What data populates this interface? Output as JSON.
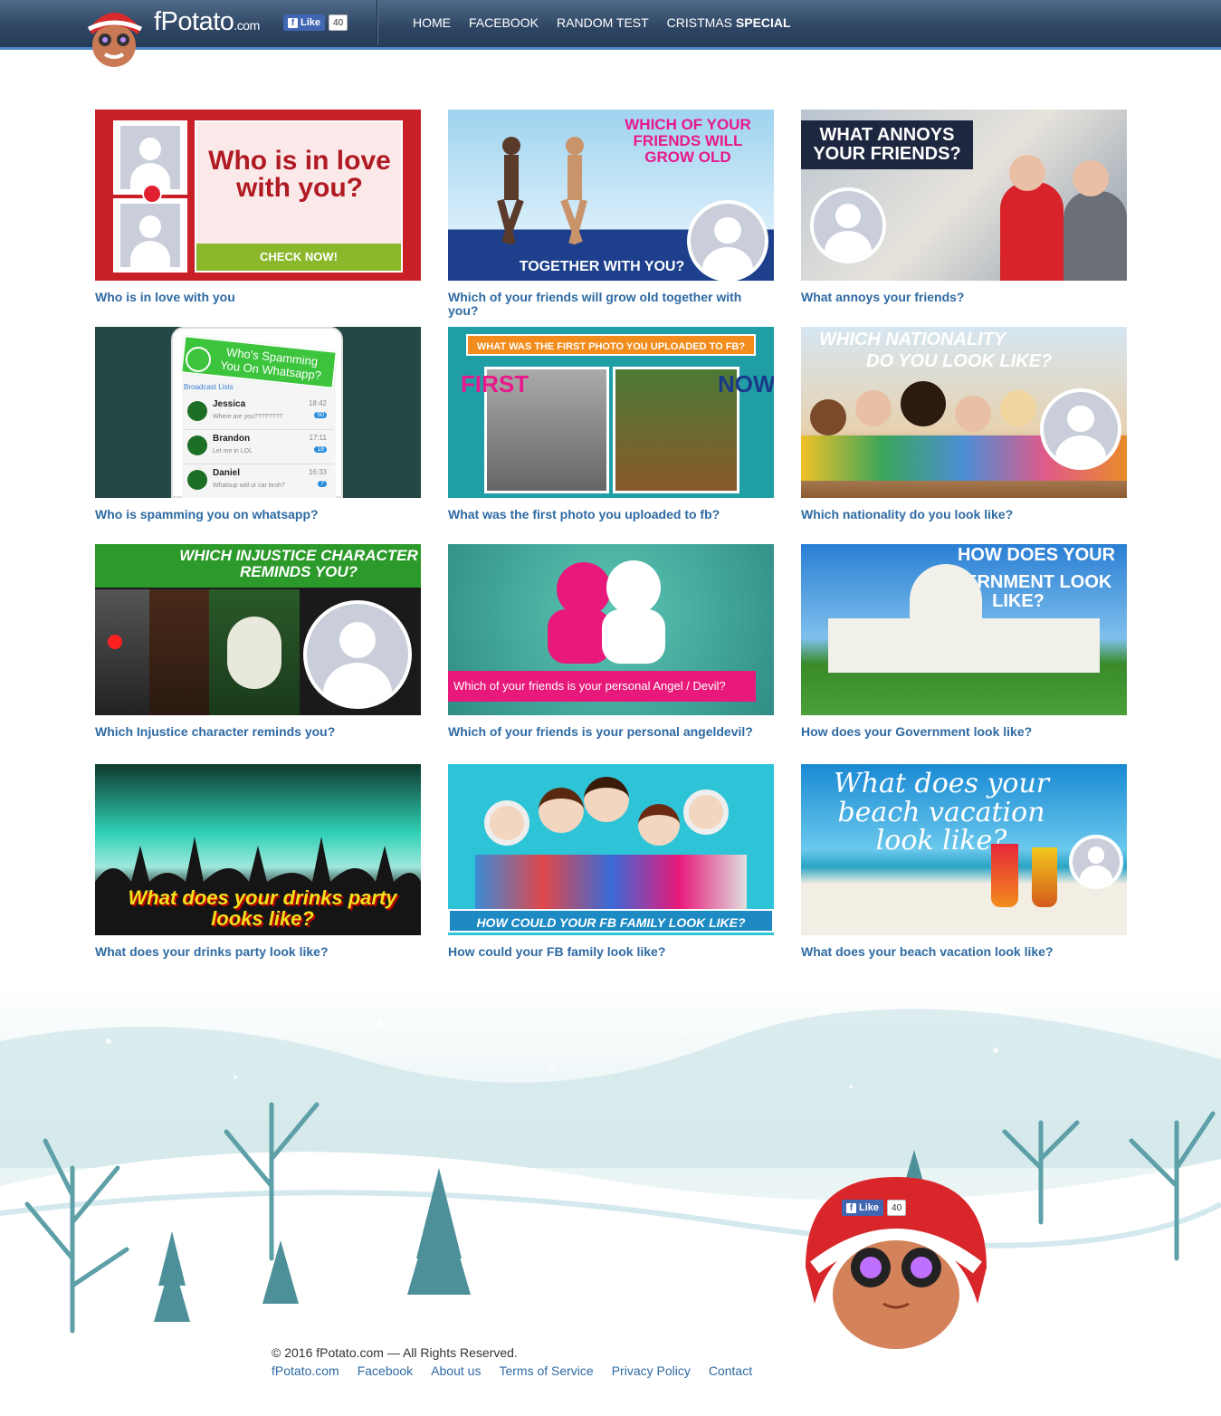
{
  "brand": {
    "name": "fPotato",
    "domain": ".com"
  },
  "fb_like": {
    "label": "Like",
    "count": "40"
  },
  "nav": [
    {
      "label": "HOME"
    },
    {
      "label": "FACEBOOK"
    },
    {
      "label": "RANDOM TEST"
    },
    {
      "label_prefix": "CRISTMAS",
      "label_bold": "SPECIAL"
    }
  ],
  "tests": [
    {
      "caption": "Who is in love with you",
      "banner": "Who is in love with you?",
      "cta": "CHECK NOW!"
    },
    {
      "caption": "Which of your friends will grow old together with you?",
      "banner": "WHICH OF YOUR FRIENDS WILL GROW OLD",
      "banner2": "TOGETHER WITH YOU?"
    },
    {
      "caption": "What annoys your friends?",
      "banner": "WHAT ANNOYS YOUR FRIENDS?"
    },
    {
      "caption": "Who is spamming you on whatsapp?",
      "banner": "Who's Spamming You On Whatsapp?",
      "list_header": "Broadcast Lists",
      "contacts": [
        {
          "name": "Jessica",
          "msg": "Where are you????????",
          "time": "18:42",
          "badge": "50"
        },
        {
          "name": "Brandon",
          "msg": "Let me in LOL",
          "time": "17:11",
          "badge": "18"
        },
        {
          "name": "Daniel",
          "msg": "Whatsup wid ur car broh?",
          "time": "16:33",
          "badge": "7"
        }
      ]
    },
    {
      "caption": "What was the first photo you uploaded to fb?",
      "banner": "WHAT WAS THE FIRST PHOTO YOU UPLOADED TO FB?",
      "left": "FIRST",
      "right": "NOW"
    },
    {
      "caption": "Which nationality do you look like?",
      "banner": "WHICH NATIONALITY",
      "banner2": "DO YOU LOOK LIKE?"
    },
    {
      "caption": "Which Injustice character reminds you?",
      "banner": "WHICH INJUSTICE CHARACTER REMINDS YOU?"
    },
    {
      "caption": "Which of your friends is your personal angeldevil?",
      "banner": "Which of your friends is your personal Angel / Devil?"
    },
    {
      "caption": "How does your Government look like?",
      "banner": "HOW DOES YOUR",
      "banner2": "GOVERNMENT LOOK LIKE?"
    },
    {
      "caption": "What does your drinks party look like?",
      "banner": "What does your drinks party looks like?"
    },
    {
      "caption": "How could your FB family look like?",
      "banner": "HOW COULD YOUR FB FAMILY LOOK LIKE?"
    },
    {
      "caption": "What does your beach vacation look like?",
      "banner": "What does your beach vacation look like?"
    }
  ],
  "footer": {
    "copyright": "© 2016 fPotato.com — All Rights Reserved.",
    "links": [
      "fPotato.com",
      "Facebook",
      "About us",
      "Terms of Service",
      "Privacy Policy",
      "Contact"
    ]
  },
  "colors": {
    "header": "#2d4563",
    "accent": "#4a86c8",
    "link": "#2e6aa3"
  }
}
